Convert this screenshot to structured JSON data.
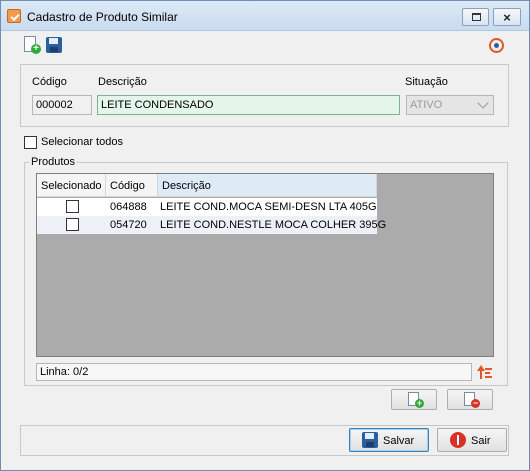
{
  "window": {
    "title": "Cadastro de Produto Similar",
    "close_glyph": "×"
  },
  "toolbar": {
    "new_icon": "new-document-icon",
    "save_icon": "save-icon",
    "power_icon": "power-icon"
  },
  "form": {
    "code_label": "Código",
    "code_value": "000002",
    "description_label": "Descrição",
    "description_value": "LEITE CONDENSADO",
    "status_label": "Situação",
    "status_value": "ATIVO"
  },
  "select_all_label": "Selecionar todos",
  "products": {
    "group_title": "Produtos",
    "columns": [
      "Selecionado",
      "Código",
      "Descrição"
    ],
    "rows": [
      {
        "selected": false,
        "code": "064888",
        "description": "LEITE COND.MOCA SEMI-DESN LTA 405G"
      },
      {
        "selected": false,
        "code": "054720",
        "description": "LEITE COND.NESTLE MOCA COLHER 395G"
      }
    ],
    "status_text": "Linha: 0/2"
  },
  "buttons": {
    "save": "Salvar",
    "exit": "Sair"
  },
  "colors": {
    "description_field_bg": "#e4f6ea",
    "accent_orange": "#e4552a",
    "save_blue": "#2a5f9e"
  }
}
